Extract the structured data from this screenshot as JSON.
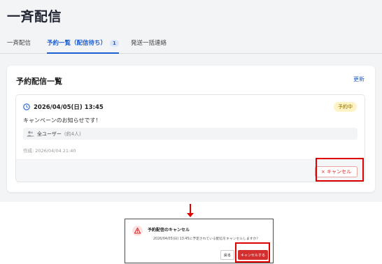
{
  "page": {
    "title": "一斉配信"
  },
  "tabs": [
    {
      "label": "一斉配信"
    },
    {
      "label": "予約一覧（配信待ち）",
      "badge": "1",
      "active": true
    },
    {
      "label": "発送一括連絡"
    }
  ],
  "card": {
    "title": "予約配信一覧",
    "refresh_label": "更新"
  },
  "item": {
    "datetime": "2026/04/05(日) 13:45",
    "status": "予約中",
    "message": "キャンペーンのお知らせです！",
    "target_label": "全ユーザー",
    "target_count": "(約4人)",
    "created": "作成: 2026/04/04 21:40",
    "cancel_label": "× キャンセル"
  },
  "dialog": {
    "title": "予約配信のキャンセル",
    "message": "2026/04/05(日) 13:45に予定されている配信をキャンセルしますか？",
    "back_label": "戻る",
    "confirm_label": "キャンセルする"
  },
  "colors": {
    "accent": "#1d5fd0",
    "danger": "#d32f2f",
    "highlight": "#e00000"
  },
  "icons": [
    "clock-icon",
    "users-icon",
    "warning-icon",
    "down-arrow-icon"
  ]
}
